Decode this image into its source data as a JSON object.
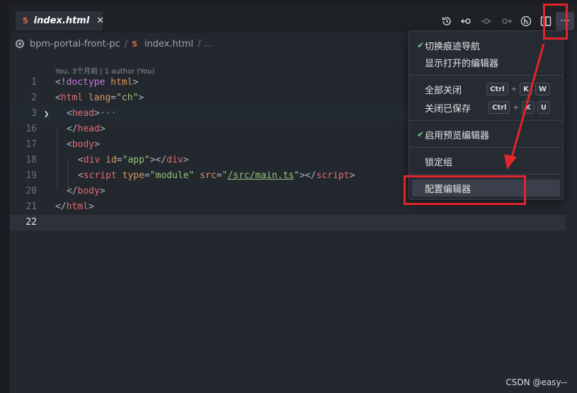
{
  "tab": {
    "icon": "html5-file-icon",
    "icon_glyph": "5",
    "label": "index.html",
    "close": "✕"
  },
  "toolbar": {
    "actions": [
      {
        "name": "timeline-history-icon"
      },
      {
        "name": "go-back-icon"
      },
      {
        "name": "previous-change-icon"
      },
      {
        "name": "next-change-icon"
      },
      {
        "name": "git-graph-icon"
      },
      {
        "name": "split-editor-icon"
      }
    ],
    "more_label": "···"
  },
  "breadcrumb": {
    "folder": "bpm-portal-front-pc",
    "sep": "/",
    "file_icon_glyph": "5",
    "file": "index.html",
    "tail": "/ ..."
  },
  "blame": "You, 3个月前 | 1 author (You)",
  "lines": [
    {
      "n": "1"
    },
    {
      "n": "2"
    },
    {
      "n": "3"
    },
    {
      "n": "16"
    },
    {
      "n": "17"
    },
    {
      "n": "18"
    },
    {
      "n": "19"
    },
    {
      "n": "20"
    },
    {
      "n": "21"
    },
    {
      "n": "22"
    }
  ],
  "code": {
    "l1": {
      "a": "<!",
      "b": "doctype",
      "c": " html",
      "d": ">"
    },
    "l2": {
      "a": "<",
      "b": "html",
      "c": " lang",
      "d": "=",
      "e": "\"ch\"",
      "f": ">"
    },
    "l3": {
      "a": "<",
      "b": "head",
      "c": ">",
      "d": "···"
    },
    "l16": {
      "a": "</",
      "b": "head",
      "c": ">"
    },
    "l17": {
      "a": "<",
      "b": "body",
      "c": ">"
    },
    "l18": {
      "a": "<",
      "b": "div",
      "c": " id",
      "d": "=",
      "e": "\"app\"",
      "f": "></",
      "g": "div",
      "h": ">"
    },
    "l19": {
      "a": "<",
      "b": "script",
      "c": " type",
      "d": "=",
      "e": "\"module\"",
      "f": " src",
      "g": "=",
      "h": "\"",
      "i": "/src/main.ts",
      "j": "\"",
      "k": "></",
      "l": "script",
      "m": ">"
    },
    "l20": {
      "a": "</",
      "b": "body",
      "c": ">"
    },
    "l21": {
      "a": "</",
      "b": "html",
      "c": ">"
    }
  },
  "fold_marker": "❯",
  "menu": {
    "items": [
      {
        "label": "切换痕迹导航",
        "checked": true,
        "check_glyph": "✔"
      },
      {
        "label": "显示打开的编辑器"
      },
      {
        "label": "全部关闭",
        "keys": [
          "Ctrl",
          "+",
          "K",
          "W"
        ]
      },
      {
        "label": "关闭已保存",
        "keys": [
          "Ctrl",
          "+",
          "K",
          "U"
        ]
      },
      {
        "label": "启用预览编辑器",
        "checked": true,
        "check_glyph": "✔"
      },
      {
        "label": "锁定组"
      },
      {
        "label": "配置编辑器"
      }
    ]
  },
  "watermark": "CSDN @easy--",
  "colors": {
    "accent_red": "#e0252b",
    "tag": "#e06c75",
    "attr": "#d19a66",
    "string": "#98c379",
    "keyword": "#c678dd",
    "check": "#73c991"
  }
}
